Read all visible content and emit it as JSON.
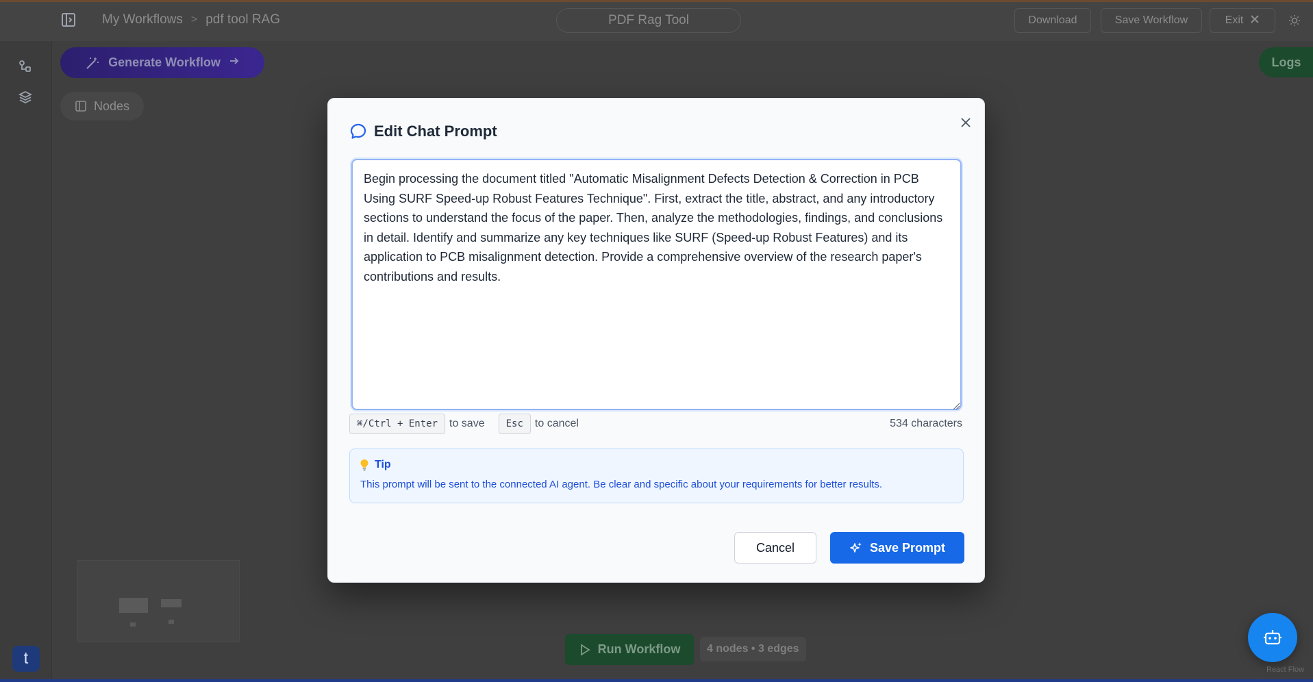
{
  "header": {
    "breadcrumb": [
      "My Workflows",
      "pdf tool RAG"
    ],
    "breadcrumb_separator": ">",
    "workflow_title": "PDF Rag Tool",
    "download_label": "Download",
    "save_workflow_label": "Save Workflow",
    "exit_label": "Exit"
  },
  "sidebar": {
    "user_initial": "t"
  },
  "canvas": {
    "generate_label": "Generate Workflow",
    "nodes_label": "Nodes",
    "logs_label": "Logs",
    "run_label": "Run Workflow",
    "stats": "4 nodes • 3 edges",
    "attribution": "React Flow"
  },
  "modal": {
    "title": "Edit Chat Prompt",
    "prompt_text": "Begin processing the document titled \"Automatic Misalignment Defects Detection & Correction in PCB Using SURF Speed-up Robust Features Technique\". First, extract the title, abstract, and any introductory sections to understand the focus of the paper. Then, analyze the methodologies, findings, and conclusions in detail. Identify and summarize any key techniques like SURF (Speed-up Robust Features) and its application to PCB misalignment detection. Provide a comprehensive overview of the research paper's contributions and results.",
    "save_shortcut": "⌘/Ctrl + Enter",
    "save_hint": "to save",
    "cancel_shortcut": "Esc",
    "cancel_hint": "to cancel",
    "char_count": "534 characters",
    "tip_title": "Tip",
    "tip_text": "This prompt will be sent to the connected AI agent. Be clear and specific about your requirements for better results.",
    "cancel_label": "Cancel",
    "save_label": "Save Prompt"
  },
  "colors": {
    "primary": "#1769e8",
    "tip_text": "#1d4ed8",
    "tip_bg": "#eff6ff",
    "run_green": "#1b4a2c",
    "assistant_blue": "#1685f0"
  }
}
